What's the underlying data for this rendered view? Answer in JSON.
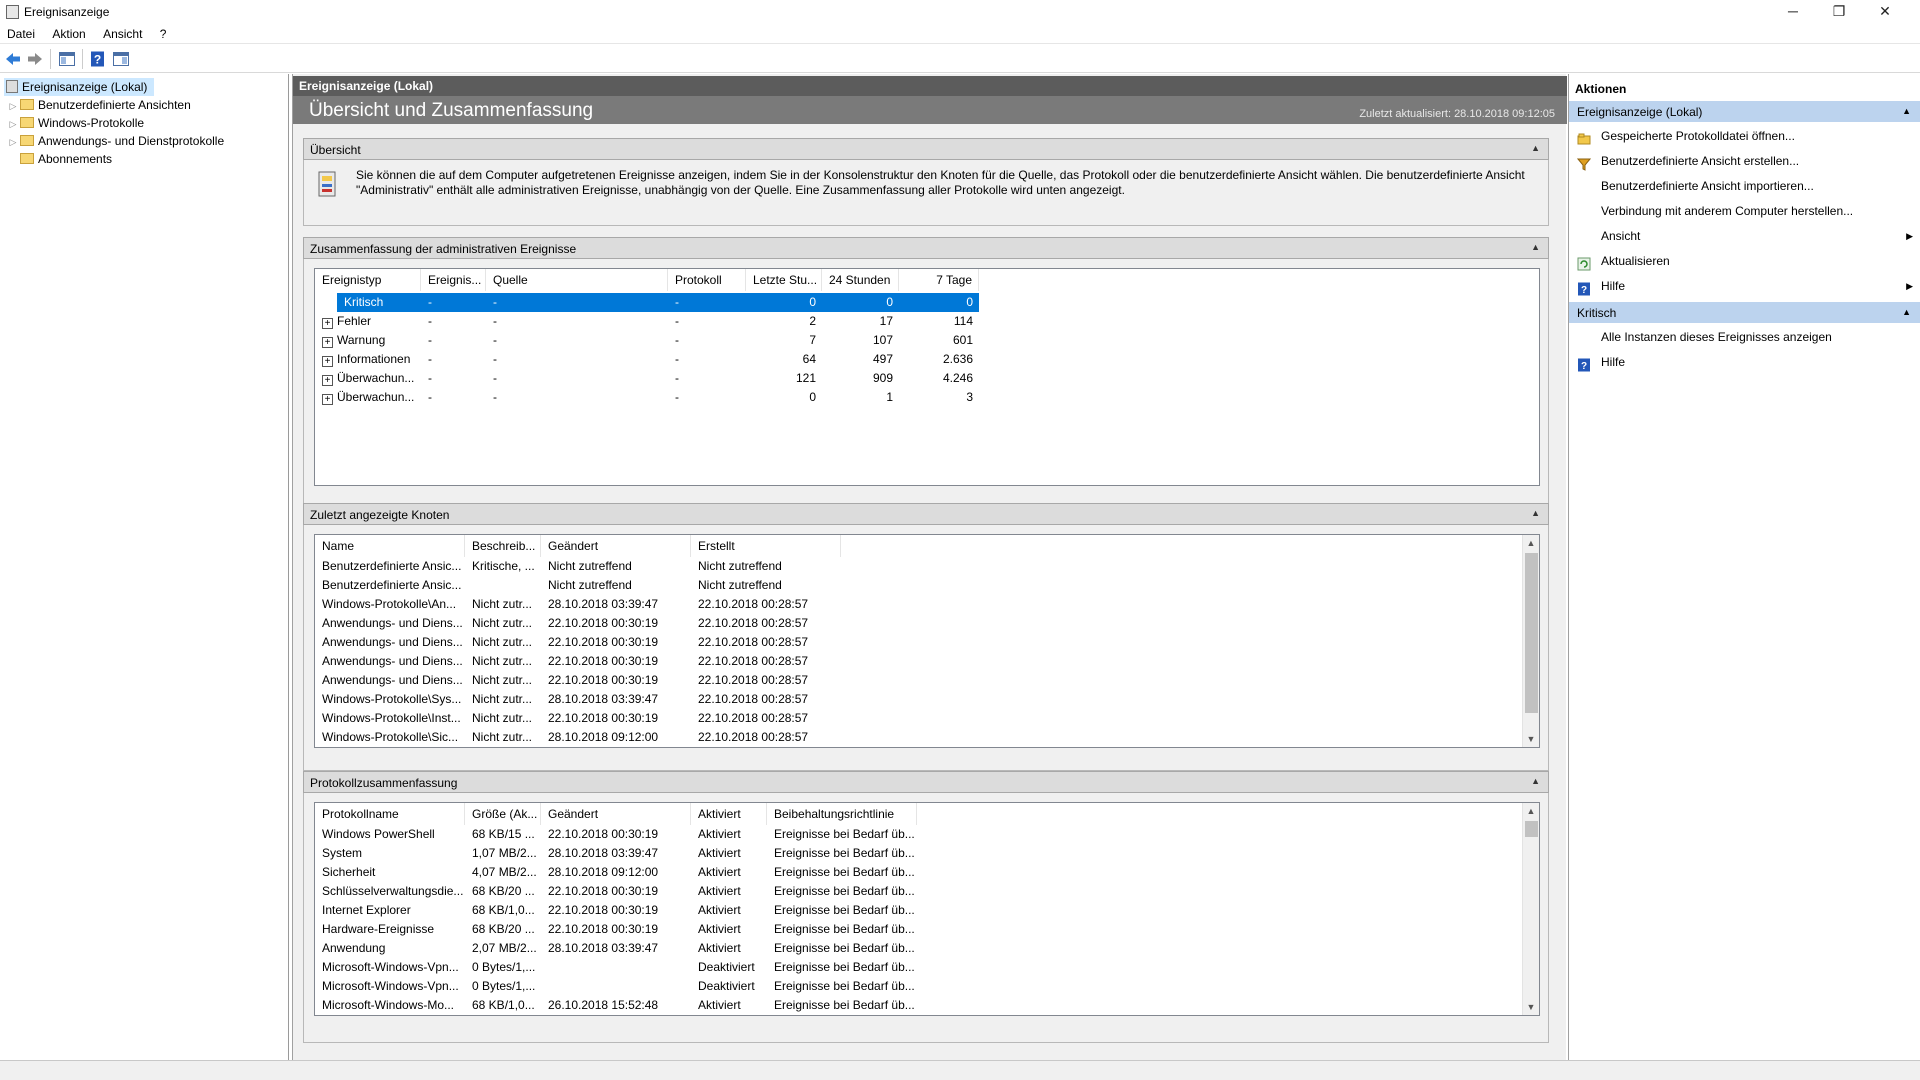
{
  "window": {
    "title": "Ereignisanzeige",
    "controls": [
      "─",
      "❐",
      "✕"
    ]
  },
  "menu": [
    "Datei",
    "Aktion",
    "Ansicht",
    "?"
  ],
  "toolbar": {
    "icons": [
      "back-arrow-icon",
      "forward-arrow-icon",
      "show-hide-tree-icon",
      "help-icon",
      "show-hide-action-pane-icon"
    ]
  },
  "tree": [
    {
      "label": "Ereignisanzeige (Lokal)",
      "selected": true
    },
    {
      "label": "Benutzerdefinierte Ansichten"
    },
    {
      "label": "Windows-Protokolle"
    },
    {
      "label": "Anwendungs- und Dienstprotokolle"
    },
    {
      "label": "Abonnements"
    }
  ],
  "center": {
    "header": "Ereignisanzeige (Lokal)",
    "banner_title": "Übersicht und Zusammenfassung",
    "last_updated": "Zuletzt aktualisiert: 28.10.2018 09:12:05",
    "overview": {
      "title": "Übersicht",
      "text": "Sie können die auf dem Computer aufgetretenen Ereignisse anzeigen, indem Sie in der Konsolenstruktur den Knoten für die Quelle, das Protokoll oder die benutzerdefinierte Ansicht wählen. Die benutzerdefinierte Ansicht \"Administrativ\" enthält alle administrativen Ereignisse, unabhängig von der Quelle. Eine Zusammenfassung aller Protokolle wird unten angezeigt."
    },
    "admin_summary": {
      "title": "Zusammenfassung der administrativen Ereignisse",
      "columns": [
        "Ereignistyp",
        "Ereignis...",
        "Quelle",
        "Protokoll",
        "Letzte Stu...",
        "24 Stunden",
        "7 Tage"
      ],
      "rows": [
        [
          "Kritisch",
          "-",
          "-",
          "-",
          "0",
          "0",
          "0"
        ],
        [
          "Fehler",
          "-",
          "-",
          "-",
          "2",
          "17",
          "114"
        ],
        [
          "Warnung",
          "-",
          "-",
          "-",
          "7",
          "107",
          "601"
        ],
        [
          "Informationen",
          "-",
          "-",
          "-",
          "64",
          "497",
          "2.636"
        ],
        [
          "Überwachun...",
          "-",
          "-",
          "-",
          "121",
          "909",
          "4.246"
        ],
        [
          "Überwachun...",
          "-",
          "-",
          "-",
          "0",
          "1",
          "3"
        ]
      ]
    },
    "recent_nodes": {
      "title": "Zuletzt angezeigte Knoten",
      "columns": [
        "Name",
        "Beschreib...",
        "Geändert",
        "Erstellt"
      ],
      "rows": [
        [
          "Benutzerdefinierte Ansic...",
          "Kritische, ...",
          "Nicht zutreffend",
          "Nicht zutreffend"
        ],
        [
          "Benutzerdefinierte Ansic...",
          "",
          "Nicht zutreffend",
          "Nicht zutreffend"
        ],
        [
          "Windows-Protokolle\\An...",
          "Nicht zutr...",
          "28.10.2018 03:39:47",
          "22.10.2018 00:28:57"
        ],
        [
          "Anwendungs- und Diens...",
          "Nicht zutr...",
          "22.10.2018 00:30:19",
          "22.10.2018 00:28:57"
        ],
        [
          "Anwendungs- und Diens...",
          "Nicht zutr...",
          "22.10.2018 00:30:19",
          "22.10.2018 00:28:57"
        ],
        [
          "Anwendungs- und Diens...",
          "Nicht zutr...",
          "22.10.2018 00:30:19",
          "22.10.2018 00:28:57"
        ],
        [
          "Anwendungs- und Diens...",
          "Nicht zutr...",
          "22.10.2018 00:30:19",
          "22.10.2018 00:28:57"
        ],
        [
          "Windows-Protokolle\\Sys...",
          "Nicht zutr...",
          "28.10.2018 03:39:47",
          "22.10.2018 00:28:57"
        ],
        [
          "Windows-Protokolle\\Inst...",
          "Nicht zutr...",
          "22.10.2018 00:30:19",
          "22.10.2018 00:28:57"
        ],
        [
          "Windows-Protokolle\\Sic...",
          "Nicht zutr...",
          "28.10.2018 09:12:00",
          "22.10.2018 00:28:57"
        ]
      ]
    },
    "log_summary": {
      "title": "Protokollzusammenfassung",
      "columns": [
        "Protokollname",
        "Größe (Ak...",
        "Geändert",
        "Aktiviert",
        "Beibehaltungsrichtlinie"
      ],
      "rows": [
        [
          "Windows PowerShell",
          "68 KB/15 ...",
          "22.10.2018 00:30:19",
          "Aktiviert",
          "Ereignisse bei Bedarf üb..."
        ],
        [
          "System",
          "1,07 MB/2...",
          "28.10.2018 03:39:47",
          "Aktiviert",
          "Ereignisse bei Bedarf üb..."
        ],
        [
          "Sicherheit",
          "4,07 MB/2...",
          "28.10.2018 09:12:00",
          "Aktiviert",
          "Ereignisse bei Bedarf üb..."
        ],
        [
          "Schlüsselverwaltungsdie...",
          "68 KB/20 ...",
          "22.10.2018 00:30:19",
          "Aktiviert",
          "Ereignisse bei Bedarf üb..."
        ],
        [
          "Internet Explorer",
          "68 KB/1,0...",
          "22.10.2018 00:30:19",
          "Aktiviert",
          "Ereignisse bei Bedarf üb..."
        ],
        [
          "Hardware-Ereignisse",
          "68 KB/20 ...",
          "22.10.2018 00:30:19",
          "Aktiviert",
          "Ereignisse bei Bedarf üb..."
        ],
        [
          "Anwendung",
          "2,07 MB/2...",
          "28.10.2018 03:39:47",
          "Aktiviert",
          "Ereignisse bei Bedarf üb..."
        ],
        [
          "Microsoft-Windows-Vpn...",
          "0 Bytes/1,...",
          "",
          "Deaktiviert",
          "Ereignisse bei Bedarf üb..."
        ],
        [
          "Microsoft-Windows-Vpn...",
          "0 Bytes/1,...",
          "",
          "Deaktiviert",
          "Ereignisse bei Bedarf üb..."
        ],
        [
          "Microsoft-Windows-Mo...",
          "68 KB/1,0...",
          "26.10.2018 15:52:48",
          "Aktiviert",
          "Ereignisse bei Bedarf üb..."
        ]
      ]
    }
  },
  "actions": {
    "title": "Aktionen",
    "group1": {
      "title": "Ereignisanzeige (Lokal)",
      "items": [
        {
          "label": "Gespeicherte Protokolldatei öffnen...",
          "icon": "open-log-icon"
        },
        {
          "label": "Benutzerdefinierte Ansicht erstellen...",
          "icon": "filter-icon"
        },
        {
          "label": "Benutzerdefinierte Ansicht importieren...",
          "icon": ""
        },
        {
          "label": "Verbindung mit anderem Computer herstellen...",
          "icon": ""
        },
        {
          "label": "Ansicht",
          "icon": "",
          "submenu": true
        },
        {
          "label": "Aktualisieren",
          "icon": "refresh-icon"
        },
        {
          "label": "Hilfe",
          "icon": "help-icon",
          "submenu": true
        }
      ]
    },
    "group2": {
      "title": "Kritisch",
      "items": [
        {
          "label": "Alle Instanzen dieses Ereignisses anzeigen",
          "icon": ""
        },
        {
          "label": "Hilfe",
          "icon": "help-icon"
        }
      ]
    }
  },
  "colors": {
    "selection": "#0078d7",
    "header_dark": "#5c5c5c",
    "banner": "#7a7a7a",
    "action_group": "#bcd3ee"
  }
}
